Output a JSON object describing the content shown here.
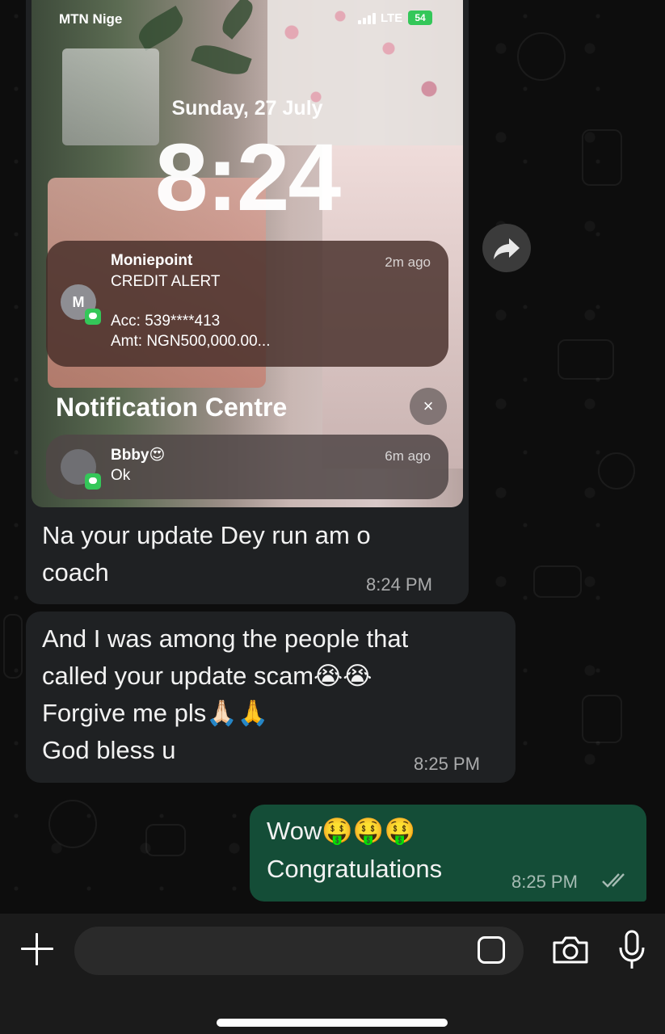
{
  "screenshot": {
    "carrier": "MTN Nige",
    "network": "LTE",
    "battery": "54",
    "date": "Sunday, 27 July",
    "time": "8:24",
    "notification_centre_title": "Notification Centre",
    "close_symbol": "×",
    "notifications": [
      {
        "avatar_initial": "M",
        "app": "Moniepoint",
        "title": "CREDIT ALERT",
        "lines": [
          "Acc: 539****413",
          "Amt: NGN500,000.00..."
        ],
        "ago": "2m ago"
      },
      {
        "avatar_initial": "",
        "app": "Bbby😍",
        "lines": [
          "Ok"
        ],
        "ago": "6m ago"
      }
    ]
  },
  "messages": [
    {
      "direction": "incoming",
      "lines": [
        "Na your update Dey run am o",
        "coach"
      ],
      "time": "8:24 PM"
    },
    {
      "direction": "incoming",
      "lines": [
        "And I was among the people that",
        "called your update scam😭😭",
        "Forgive me pls🙏🏻🙏",
        "God bless u"
      ],
      "time": "8:25 PM"
    },
    {
      "direction": "outgoing",
      "lines": [
        "Wow🤑🤑🤑",
        "Congratulations"
      ],
      "time": "8:25 PM",
      "status": "read"
    }
  ],
  "input": {
    "placeholder": ""
  },
  "icons": {
    "forward": "forward-icon",
    "attach": "plus-icon",
    "sticker": "sticker-icon",
    "camera": "camera-icon",
    "mic": "microphone-icon",
    "read_ticks": "double-check-icon"
  },
  "colors": {
    "incoming_bubble": "#1f2123",
    "outgoing_bubble": "#144d37",
    "background": "#0b0b0b",
    "input_bar": "#1b1b1b"
  }
}
